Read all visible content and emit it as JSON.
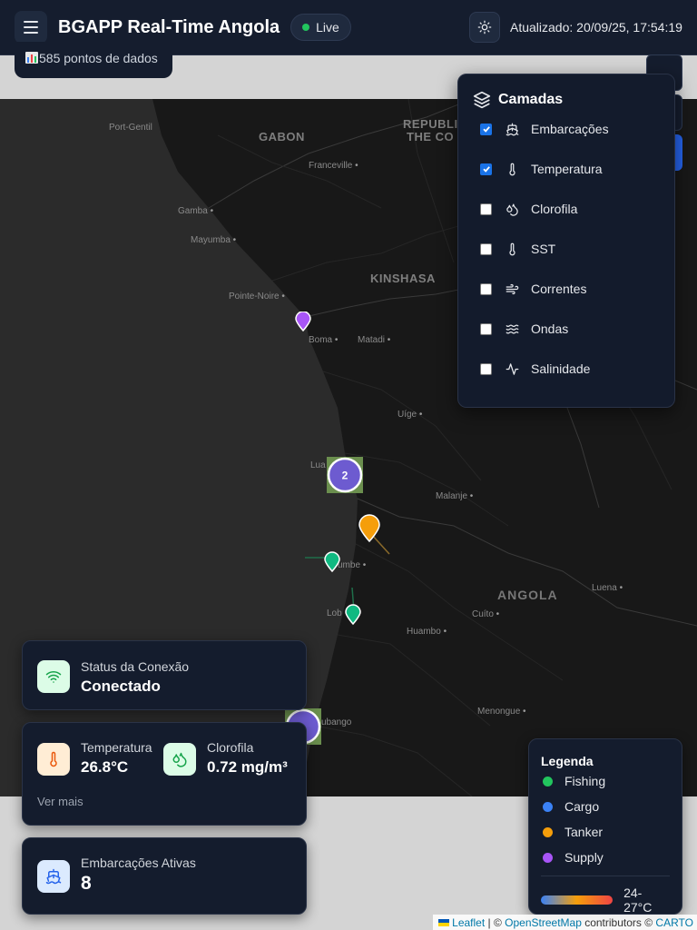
{
  "header": {
    "title": "BGAPP Real-Time Angola",
    "live_label": "Live",
    "updated": "Atualizado: 20/09/25, 17:54:19"
  },
  "data_points": "585 pontos de dados",
  "layers": {
    "title": "Camadas",
    "items": [
      {
        "label": "Embarcações",
        "checked": true,
        "icon": "ship-icon"
      },
      {
        "label": "Temperatura",
        "checked": true,
        "icon": "thermometer-icon"
      },
      {
        "label": "Clorofila",
        "checked": false,
        "icon": "droplets-icon"
      },
      {
        "label": "SST",
        "checked": false,
        "icon": "thermometer-icon"
      },
      {
        "label": "Correntes",
        "checked": false,
        "icon": "wind-icon"
      },
      {
        "label": "Ondas",
        "checked": false,
        "icon": "waves-icon"
      },
      {
        "label": "Salinidade",
        "checked": false,
        "icon": "activity-icon"
      }
    ]
  },
  "map": {
    "labels": {
      "port_gentil": "Port-Gentil",
      "gabon": "GABON",
      "republic_1": "REPUBLIC",
      "republic_2": "THE CO",
      "franceville": "Franceville",
      "gamba": "Gamba",
      "mayumba": "Mayumba",
      "kinshasa": "KINSHASA",
      "pointe_noire": "Pointe-Noire",
      "boma": "Boma",
      "matadi": "Matadi",
      "uige": "Uíge",
      "luanda": "Lua",
      "malanje": "Malanje",
      "sumbe": "umbe",
      "angola": "ANGOLA",
      "luena": "Luena",
      "lobito": "Lob",
      "cuito": "Cuíto",
      "huambo": "Huambo",
      "lubango": "ubango",
      "menongue": "Menongue"
    },
    "cluster_count": "2"
  },
  "connection": {
    "title": "Status da Conexão",
    "value": "Conectado"
  },
  "metrics": {
    "temperature_label": "Temperatura",
    "temperature_value": "26.8°C",
    "chlorophyll_label": "Clorofila",
    "chlorophyll_value": "0.72 mg/m³",
    "more": "Ver mais"
  },
  "vessels": {
    "title": "Embarcações Ativas",
    "count": "8"
  },
  "legend": {
    "title": "Legenda",
    "items": [
      {
        "label": "Fishing",
        "color": "#22c55e"
      },
      {
        "label": "Cargo",
        "color": "#3b82f6"
      },
      {
        "label": "Tanker",
        "color": "#f59e0b"
      },
      {
        "label": "Supply",
        "color": "#a855f7"
      }
    ],
    "scale_label": "24-27°C"
  },
  "attribution": {
    "leaflet": "Leaflet",
    "sep": " | © ",
    "osm": "OpenStreetMap",
    "contrib": " contributors © ",
    "carto": "CARTO"
  }
}
